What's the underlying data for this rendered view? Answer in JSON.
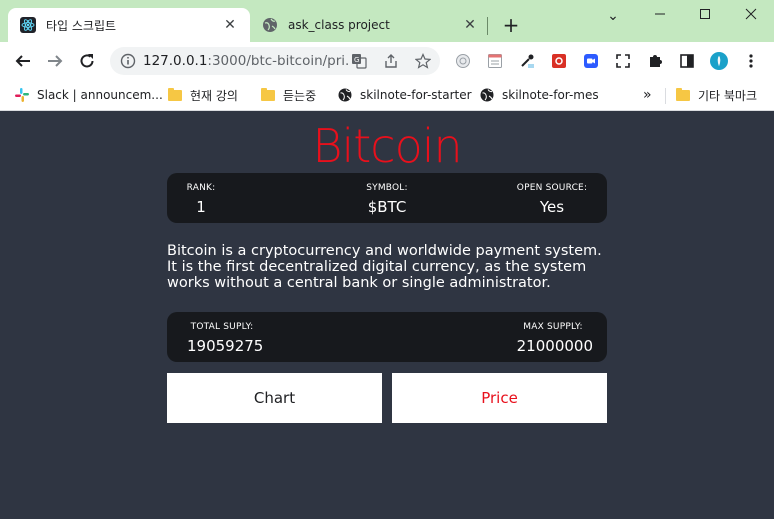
{
  "browser": {
    "tabs": [
      {
        "title": "타입 스크립트",
        "active": true,
        "icon": "react-icon"
      },
      {
        "title": "ask_class project",
        "active": false,
        "icon": "globe-icon"
      }
    ],
    "url_host": "127.0.0.1",
    "url_path": ":3000/btc-bitcoin/pri...",
    "bookmarks": [
      {
        "label": "Slack | announcem...",
        "icon": "slack-icon"
      },
      {
        "label": "현재 강의",
        "icon": "folder-icon"
      },
      {
        "label": "듣는중",
        "icon": "folder-icon"
      },
      {
        "label": "skilnote-for-starter",
        "icon": "globe-icon"
      },
      {
        "label": "skilnote-for-mes",
        "icon": "globe-icon"
      },
      {
        "label": "기타 북마크",
        "icon": "folder-icon"
      }
    ],
    "overflow_label": "»",
    "tabstrip_color": "#c4e8c0"
  },
  "coin": {
    "name": "Bitcoin",
    "accent_color": "#e8101c",
    "overview": {
      "rank_label": "RANK:",
      "rank_value": "1",
      "symbol_label": "SYMBOL:",
      "symbol_value": "$BTC",
      "open_source_label": "OPEN SOURCE:",
      "open_source_value": "Yes"
    },
    "description": "Bitcoin is a cryptocurrency and worldwide payment system. It is the first decentralized digital currency, as the system works without a central bank or single administrator.",
    "supply": {
      "total_label": "TOTAL SUPLY:",
      "total_value": "19059275",
      "max_label": "MAX SUPPLY:",
      "max_value": "21000000"
    },
    "tabs": [
      {
        "label": "Chart",
        "active": false
      },
      {
        "label": "Price",
        "active": true
      }
    ]
  },
  "colors": {
    "page_background": "#2f3542",
    "panel_background": "#17191d"
  }
}
